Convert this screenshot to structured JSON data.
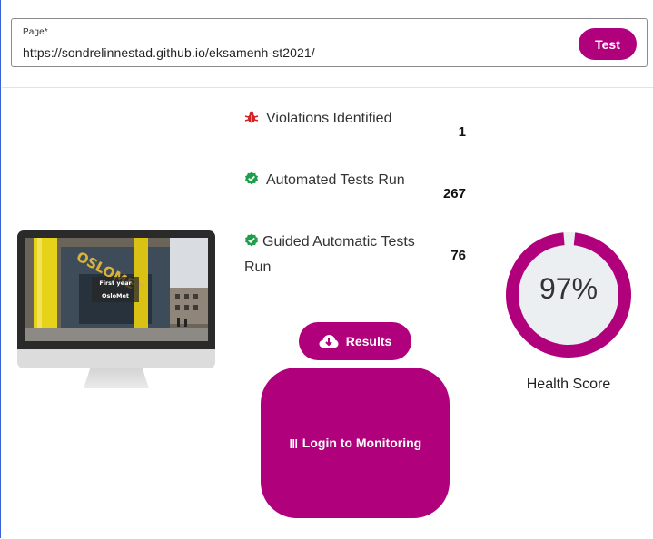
{
  "page_field": {
    "label": "Page",
    "required_mark": "*",
    "value": "https://sondrelinnestad.github.io/eksamenh-st2021/"
  },
  "test_button": {
    "label": "Test"
  },
  "preview": {
    "caption_line1": "First year",
    "caption_line2": "OsloMet",
    "sign_text": "OSLOMET"
  },
  "stats": [
    {
      "icon": "bug-icon",
      "label": "Violations Identified",
      "value": "1",
      "icon_color": "#d32020"
    },
    {
      "icon": "check-shield-icon",
      "label": "Automated Tests Run",
      "value": "267",
      "icon_color": "#1e9e4a"
    },
    {
      "icon": "check-shield-icon",
      "label": "Guided Automatic Tests Run",
      "value": "76",
      "icon_color": "#1e9e4a"
    }
  ],
  "results_button": {
    "label": "Results"
  },
  "login_button": {
    "logo": "ııı",
    "label": "Login to Monitoring"
  },
  "health": {
    "score_percent": 97,
    "score_text": "97%",
    "label": "Health Score"
  },
  "colors": {
    "accent": "#b0007c",
    "gauge_track": "#eceff1"
  }
}
